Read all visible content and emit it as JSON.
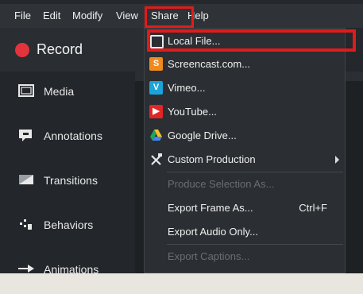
{
  "menubar": {
    "items": [
      "File",
      "Edit",
      "Modify",
      "View",
      "Share",
      "Help"
    ]
  },
  "record": {
    "label": "Record"
  },
  "sidebar": {
    "items": [
      {
        "label": "Media",
        "icon": "film-icon"
      },
      {
        "label": "Annotations",
        "icon": "speech-bubble-icon"
      },
      {
        "label": "Transitions",
        "icon": "transition-icon"
      },
      {
        "label": "Behaviors",
        "icon": "behaviors-icon"
      },
      {
        "label": "Animations",
        "icon": "arrow-icon"
      }
    ]
  },
  "share_menu": {
    "items": [
      {
        "label": "Local File...",
        "icon": "local-file-icon",
        "enabled": true
      },
      {
        "label": "Screencast.com...",
        "icon": "screencast-icon",
        "enabled": true
      },
      {
        "label": "Vimeo...",
        "icon": "vimeo-icon",
        "enabled": true
      },
      {
        "label": "YouTube...",
        "icon": "youtube-icon",
        "enabled": true
      },
      {
        "label": "Google Drive...",
        "icon": "google-drive-icon",
        "enabled": true
      },
      {
        "label": "Custom Production",
        "icon": "tools-icon",
        "enabled": true,
        "submenu": true
      },
      {
        "label": "Produce Selection As...",
        "enabled": false
      },
      {
        "label": "Export Frame As...",
        "shortcut": "Ctrl+F",
        "enabled": true
      },
      {
        "label": "Export Audio Only...",
        "enabled": true
      },
      {
        "label": "Export Captions...",
        "enabled": false
      }
    ]
  },
  "colors": {
    "highlight": "#e01b1b",
    "record": "#e3333d",
    "menu_bg": "#2b2e32"
  }
}
